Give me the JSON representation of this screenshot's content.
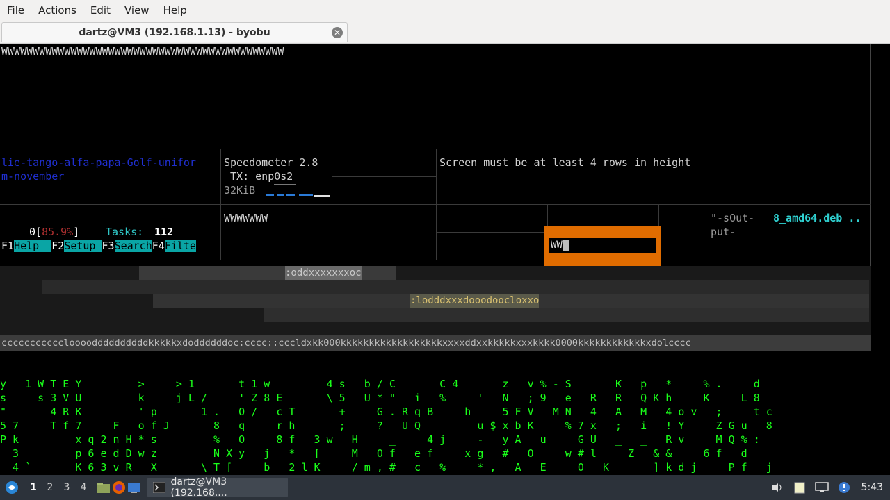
{
  "menu": {
    "items": [
      "File",
      "Actions",
      "Edit",
      "View",
      "Help"
    ]
  },
  "tab": {
    "title": "dartz@VM3 (192.168.1.13) - byobu"
  },
  "terminal": {
    "top_line": "WWWWWWWWWWWWWWWWWWWWWWWWWWWWWWWWWWWWWWWWWWWWW",
    "left_text_1": "lie-tango-alfa-papa-Golf-unifor",
    "left_text_2": "m-november",
    "speedometer_title": "Speedometer 2.8",
    "tx_label": " TX: enp0s2",
    "rate_label": "32KiB",
    "screen_msg": "Screen must be at least 4 rows in height",
    "cpu_prefix": "0[",
    "cpu_pct": "85.9%",
    "cpu_suffix": "]",
    "tasks_label": "Tasks:",
    "tasks_value": "112",
    "fkeys": [
      {
        "key": "F1",
        "label": "Help  "
      },
      {
        "key": "F2",
        "label": "Setup "
      },
      {
        "key": "F3",
        "label": "Search"
      },
      {
        "key": "F4",
        "label": "Filte"
      }
    ],
    "mid_w": "WWWWWWW",
    "popup_text": "WW",
    "sout_1": "\"-sOut-",
    "sout_2": "put-",
    "deb_text": "8_amd64.deb ..",
    "ascii_row1": ":oddxxxxxxxoc",
    "ascii_row2": ":lodddxxxdooodoocloxxo",
    "ascii_row3": "ccccccccccclooooddddddddddkkkkkxdoddddddoc:cccc::cccldxkk000kkkkkkkkkkkkkkkkkkxxxxddxxkkkkkxxxkkkk0000kkkkkkkkkkkkxdolcccc",
    "matrix_rows": [
      "y   1 W T E Y         >     > 1       t 1 w         4 s   b / C       C 4       z   v % - S       K   p   *     % .     d",
      "s     s 3 V U         k     j L /     ' Z 8 E       \\ 5   U * \"   i   %     '   N   ; 9   e   R   R   Q K h     K     L 8",
      "\"       4 R K         ' p       1 .   O /   c T       +     G . R q B     h     5 F V   M N   4   A   M   4 o v   ;     t c",
      "5 7     T f 7     F   o f J       8   q     r h       ;     ?   U Q         u $ x b K     % 7 x   ;   i   ! Y     Z G u   8",
      "P k         x q 2 n H * s         %   O     8 f   3 w   H     _     4 j     -   y A   u     G U   _   _   R v     M Q % :",
      "  3         p 6 e d D w z         N X y   j   *   [     M   O f   e f     x g   #   O     w # l     Z   & &     6 f   d",
      "  4 `       K 6 3 v R   X       \\ T [     b   2 l K     / m , #   c   %     * ,   A   E     O   K       ] k d j     P f   j"
    ]
  },
  "taskbar": {
    "workspaces": [
      "1",
      "2",
      "3",
      "4"
    ],
    "active_task": "dartz@VM3 (192.168....",
    "clock": "5:43"
  }
}
